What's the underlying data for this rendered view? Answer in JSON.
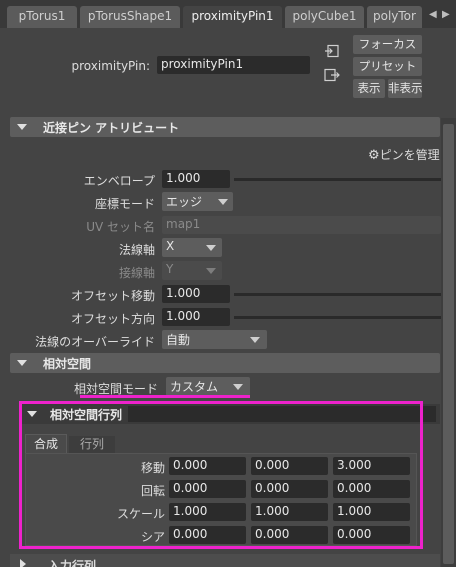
{
  "tabs": [
    "pTorus1",
    "pTorusShape1",
    "proximityPin1",
    "polyCube1",
    "polyTor"
  ],
  "header": {
    "node_label": "proximityPin:",
    "node_value": "proximityPin1",
    "buttons": {
      "focus": "フォーカス",
      "preset": "プリセット",
      "show": "表示",
      "hide": "非表示"
    }
  },
  "section_main": {
    "title": "近接ピン アトリビュート",
    "manage_pins": "ピンを管理",
    "envelope": {
      "label": "エンベロープ",
      "value": "1.000"
    },
    "coord_mode": {
      "label": "座標モード",
      "value": "エッジ"
    },
    "uvset": {
      "label": "UV セット名",
      "value": "map1"
    },
    "normal_axis": {
      "label": "法線軸",
      "value": "X"
    },
    "tangent_axis": {
      "label": "接線軸",
      "value": "Y"
    },
    "offset_translate": {
      "label": "オフセット移動",
      "value": "1.000"
    },
    "offset_orient": {
      "label": "オフセット方向",
      "value": "1.000"
    },
    "normal_override": {
      "label": "法線のオーバーライド",
      "value": "自動"
    }
  },
  "section_relative": {
    "title": "相対空間",
    "mode": {
      "label": "相対空間モード",
      "value": "カスタム"
    },
    "matrix_title": "相対空間行列",
    "subtabs": [
      "合成",
      "行列"
    ],
    "rows": [
      {
        "label": "移動",
        "values": [
          "0.000",
          "0.000",
          "3.000"
        ]
      },
      {
        "label": "回転",
        "values": [
          "0.000",
          "0.000",
          "0.000"
        ]
      },
      {
        "label": "スケール",
        "values": [
          "1.000",
          "1.000",
          "1.000"
        ]
      },
      {
        "label": "シア",
        "values": [
          "0.000",
          "0.000",
          "0.000"
        ]
      }
    ]
  },
  "section_input": {
    "title": "入力行列"
  },
  "highlight_color": "#ee22cc"
}
